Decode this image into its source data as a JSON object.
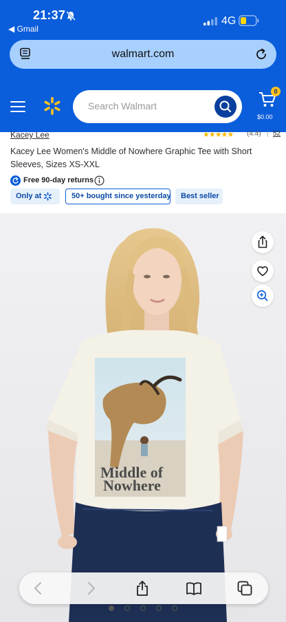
{
  "status_bar": {
    "time": "21:37",
    "back_app": "◀ Gmail",
    "network": "4G"
  },
  "browser": {
    "url": "walmart.com"
  },
  "header": {
    "search_placeholder": "Search Walmart",
    "cart_count": "0",
    "cart_total": "$0.00"
  },
  "product": {
    "brand": "Kacey Lee",
    "stars": "★★★★★",
    "rating": "(4.4)",
    "review_count": "52",
    "title": "Kacey Lee Women's Middle of Nowhere Graphic Tee with Short Sleeves, Sizes XS-XXL",
    "returns": "Free 90-day returns",
    "badges": {
      "only_at": "Only at",
      "bought": "50+ bought since yesterday",
      "best_seller": "Best seller"
    },
    "graphic_text_1": "Middle of",
    "graphic_text_2": "Nowhere"
  },
  "colors": {
    "walmart_blue": "#0a5ddb",
    "spark_yellow": "#ffc220",
    "chip_bg": "#e6f0fb"
  }
}
